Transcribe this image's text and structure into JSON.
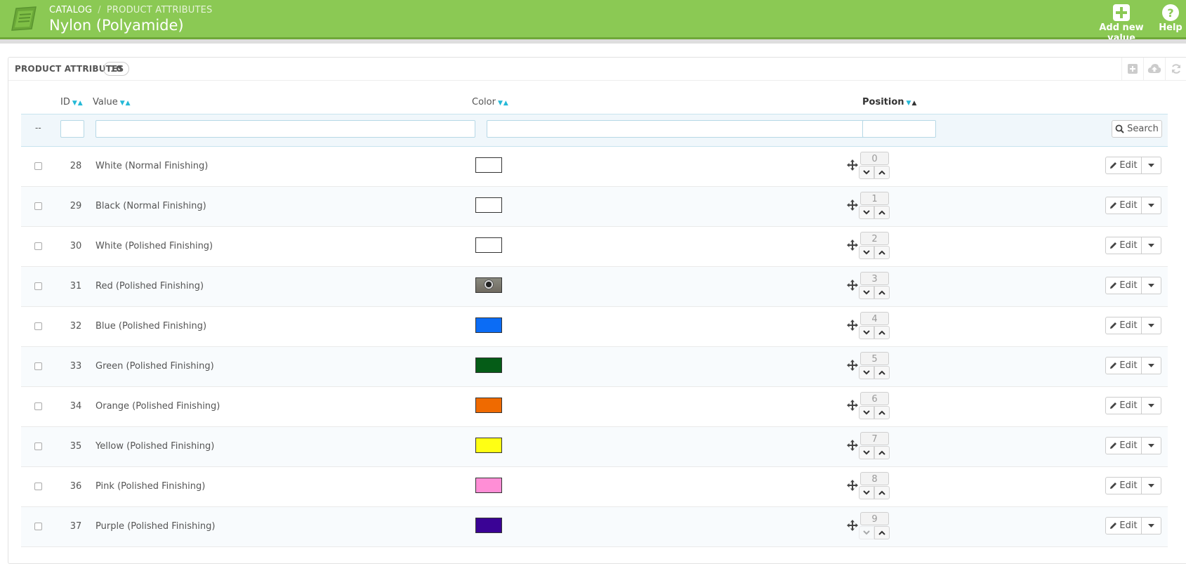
{
  "header": {
    "breadcrumb": [
      "CATALOG",
      "PRODUCT ATTRIBUTES"
    ],
    "title": "Nylon (Polyamide)",
    "add_label": "Add new value",
    "help_label": "Help"
  },
  "panel": {
    "title": "PRODUCT ATTRIBUTES",
    "count": "10"
  },
  "table": {
    "columns": {
      "id": "ID",
      "value": "Value",
      "color": "Color",
      "position": "Position"
    },
    "filter_dash": "--",
    "search_label": "Search",
    "edit_label": "Edit",
    "rows": [
      {
        "id": "28",
        "value": "White (Normal Finishing)",
        "color": "#ffffff",
        "position": "0"
      },
      {
        "id": "29",
        "value": "Black (Normal Finishing)",
        "color": "#ffffff",
        "position": "1"
      },
      {
        "id": "30",
        "value": "White (Polished Finishing)",
        "color": "#ffffff",
        "position": "2"
      },
      {
        "id": "31",
        "value": "Red (Polished Finishing)",
        "color": "texture",
        "position": "3"
      },
      {
        "id": "32",
        "value": "Blue (Polished Finishing)",
        "color": "#0b6cf5",
        "position": "4"
      },
      {
        "id": "33",
        "value": "Green (Polished Finishing)",
        "color": "#055c17",
        "position": "5"
      },
      {
        "id": "34",
        "value": "Orange (Polished Finishing)",
        "color": "#ef6a00",
        "position": "6"
      },
      {
        "id": "35",
        "value": "Yellow (Polished Finishing)",
        "color": "#ffff14",
        "position": "7"
      },
      {
        "id": "36",
        "value": "Pink (Polished Finishing)",
        "color": "#ff8ed6",
        "position": "8"
      },
      {
        "id": "37",
        "value": "Purple (Polished Finishing)",
        "color": "#3a0395",
        "position": "9"
      }
    ]
  },
  "theme": {
    "header_green": "#8bc954",
    "accent_blue": "#25b9d7"
  }
}
